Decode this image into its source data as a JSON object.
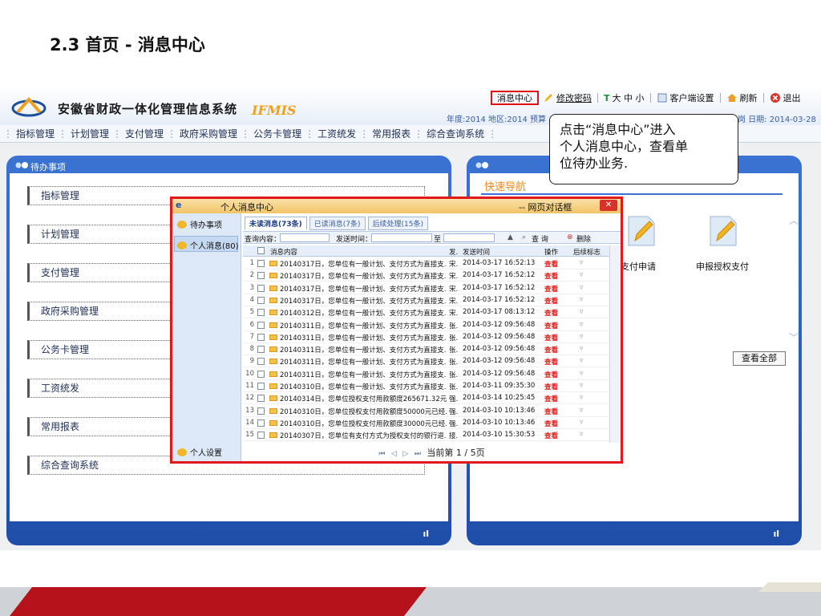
{
  "slide": {
    "title": "2.3 首页 - 消息中心"
  },
  "app": {
    "title": "安徽省财政一体化管理信息系统",
    "brand": "IFMIS",
    "toolbar": {
      "message_center": "消息中心",
      "change_password": "修改密码",
      "font_size": "大 中 小",
      "client_settings": "客户端设置",
      "refresh": "刷新",
      "exit": "退出"
    },
    "info_line": "年度:2014 地区:2014 预算",
    "info_date": "岗 日期: 2014-03-28",
    "menu": [
      "指标管理",
      "计划管理",
      "支付管理",
      "政府采购管理",
      "公务卡管理",
      "工资统发",
      "常用报表",
      "综合查询系统"
    ]
  },
  "left_panel": {
    "title": "待办事项",
    "items": [
      "指标管理",
      "计划管理",
      "支付管理",
      "政府采购管理",
      "公务卡管理",
      "工资统发",
      "常用报表",
      "综合查询系统"
    ]
  },
  "right_panel": {
    "quick_nav": "快速导航",
    "items": [
      {
        "label": "支付申请"
      },
      {
        "label": "申报授权支付"
      }
    ],
    "view_all": "查看全部"
  },
  "popup": {
    "title_left": "个人消息中心",
    "title_right": "-- 网页对话框",
    "sidebar": [
      "待办事项",
      "个人消息(80)",
      "个人设置"
    ],
    "tabs": [
      "未读消息(73条)",
      "已读消息(7条)",
      "后续处理(15条)"
    ],
    "query": {
      "content_label": "查询内容：",
      "time_label": "发送时间：",
      "to_label": "至",
      "search_button": "查 询",
      "delete_button": "删除"
    },
    "columns": [
      "消息内容",
      "发...",
      "发送时间",
      "操作",
      "后续标志"
    ],
    "rows": [
      {
        "no": "1",
        "content": "20140317日，您单位有一般计划、支付方式为直接支...",
        "sender": "宋...",
        "time": "2014-03-17 16:52:13",
        "op": "查看"
      },
      {
        "no": "2",
        "content": "20140317日，您单位有一般计划、支付方式为直接支...",
        "sender": "宋...",
        "time": "2014-03-17 16:52:12",
        "op": "查看"
      },
      {
        "no": "3",
        "content": "20140317日，您单位有一般计划、支付方式为直接支...",
        "sender": "宋...",
        "time": "2014-03-17 16:52:12",
        "op": "查看"
      },
      {
        "no": "4",
        "content": "20140317日，您单位有一般计划、支付方式为直接支...",
        "sender": "宋...",
        "time": "2014-03-17 16:52:12",
        "op": "查看"
      },
      {
        "no": "5",
        "content": "20140312日，您单位有一般计划、支付方式为直接支...",
        "sender": "宋...",
        "time": "2014-03-17 08:13:12",
        "op": "查看"
      },
      {
        "no": "6",
        "content": "20140311日，您单位有一般计划、支付方式为直接支...",
        "sender": "张...",
        "time": "2014-03-12 09:56:48",
        "op": "查看"
      },
      {
        "no": "7",
        "content": "20140311日，您单位有一般计划、支付方式为直接支...",
        "sender": "张...",
        "time": "2014-03-12 09:56:48",
        "op": "查看"
      },
      {
        "no": "8",
        "content": "20140311日，您单位有一般计划、支付方式为直接支...",
        "sender": "张...",
        "time": "2014-03-12 09:56:48",
        "op": "查看"
      },
      {
        "no": "9",
        "content": "20140311日，您单位有一般计划、支付方式为直接支...",
        "sender": "张...",
        "time": "2014-03-12 09:56:48",
        "op": "查看"
      },
      {
        "no": "10",
        "content": "20140311日，您单位有一般计划、支付方式为直接支...",
        "sender": "张...",
        "time": "2014-03-12 09:56:48",
        "op": "查看"
      },
      {
        "no": "11",
        "content": "20140310日，您单位有一般计划、支付方式为直接支...",
        "sender": "张...",
        "time": "2014-03-11 09:35:30",
        "op": "查看"
      },
      {
        "no": "12",
        "content": "20140314日，您单位授权支付用款额度265671.32元...",
        "sender": "强...",
        "time": "2014-03-14 10:25:45",
        "op": "查看"
      },
      {
        "no": "13",
        "content": "20140310日，您单位授权支付用款额度50000元已经...",
        "sender": "强...",
        "time": "2014-03-10 10:13:46",
        "op": "查看"
      },
      {
        "no": "14",
        "content": "20140310日，您单位授权支付用款额度30000元已经...",
        "sender": "强...",
        "time": "2014-03-10 10:13:46",
        "op": "查看"
      },
      {
        "no": "15",
        "content": "20140307日，您单位有支付方式为授权支付的银行退...",
        "sender": "接...",
        "time": "2014-03-10 15:30:53",
        "op": "查看"
      }
    ],
    "pager": "当前第 1 / 5页"
  },
  "callout": {
    "text": "点击“消息中心”进入\n个人消息中心，查看单\n位待办业务."
  },
  "colors": {
    "accent": "#e01a1a",
    "panel_blue": "#2a5fc0",
    "footer_red": "#b5121b"
  }
}
